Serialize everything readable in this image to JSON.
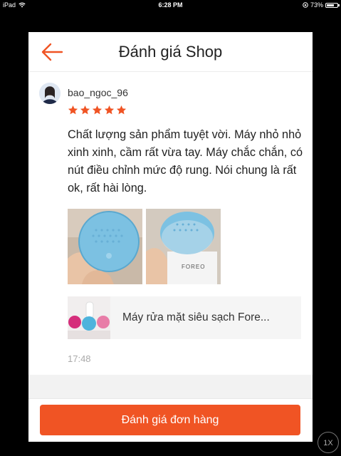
{
  "status_bar": {
    "device": "iPad",
    "time": "6:28 PM",
    "battery": "73%",
    "battery_level": 0.73
  },
  "header": {
    "title": "Đánh giá Shop",
    "back_icon": "arrow-left-icon"
  },
  "review": {
    "username": "bao_ngoc_96",
    "rating": 5,
    "max_rating": 5,
    "text": "Chất lượng sản phẩm tuyệt vời. Máy nhỏ nhỏ xinh xinh, cầm rất vừa tay. Máy chắc chắn, có nút điều chỉnh mức độ rung. Nói chung là rất ok, rất hài lòng.",
    "photo_brand_text": "FOREO",
    "time": "17:48"
  },
  "product": {
    "name": "Máy rửa mặt siêu sạch Fore..."
  },
  "footer": {
    "button_label": "Đánh giá đơn hàng"
  },
  "zoom_badge": "1X",
  "colors": {
    "accent": "#f05424",
    "star": "#f05424",
    "device_light_blue": "#7cc1e2"
  }
}
